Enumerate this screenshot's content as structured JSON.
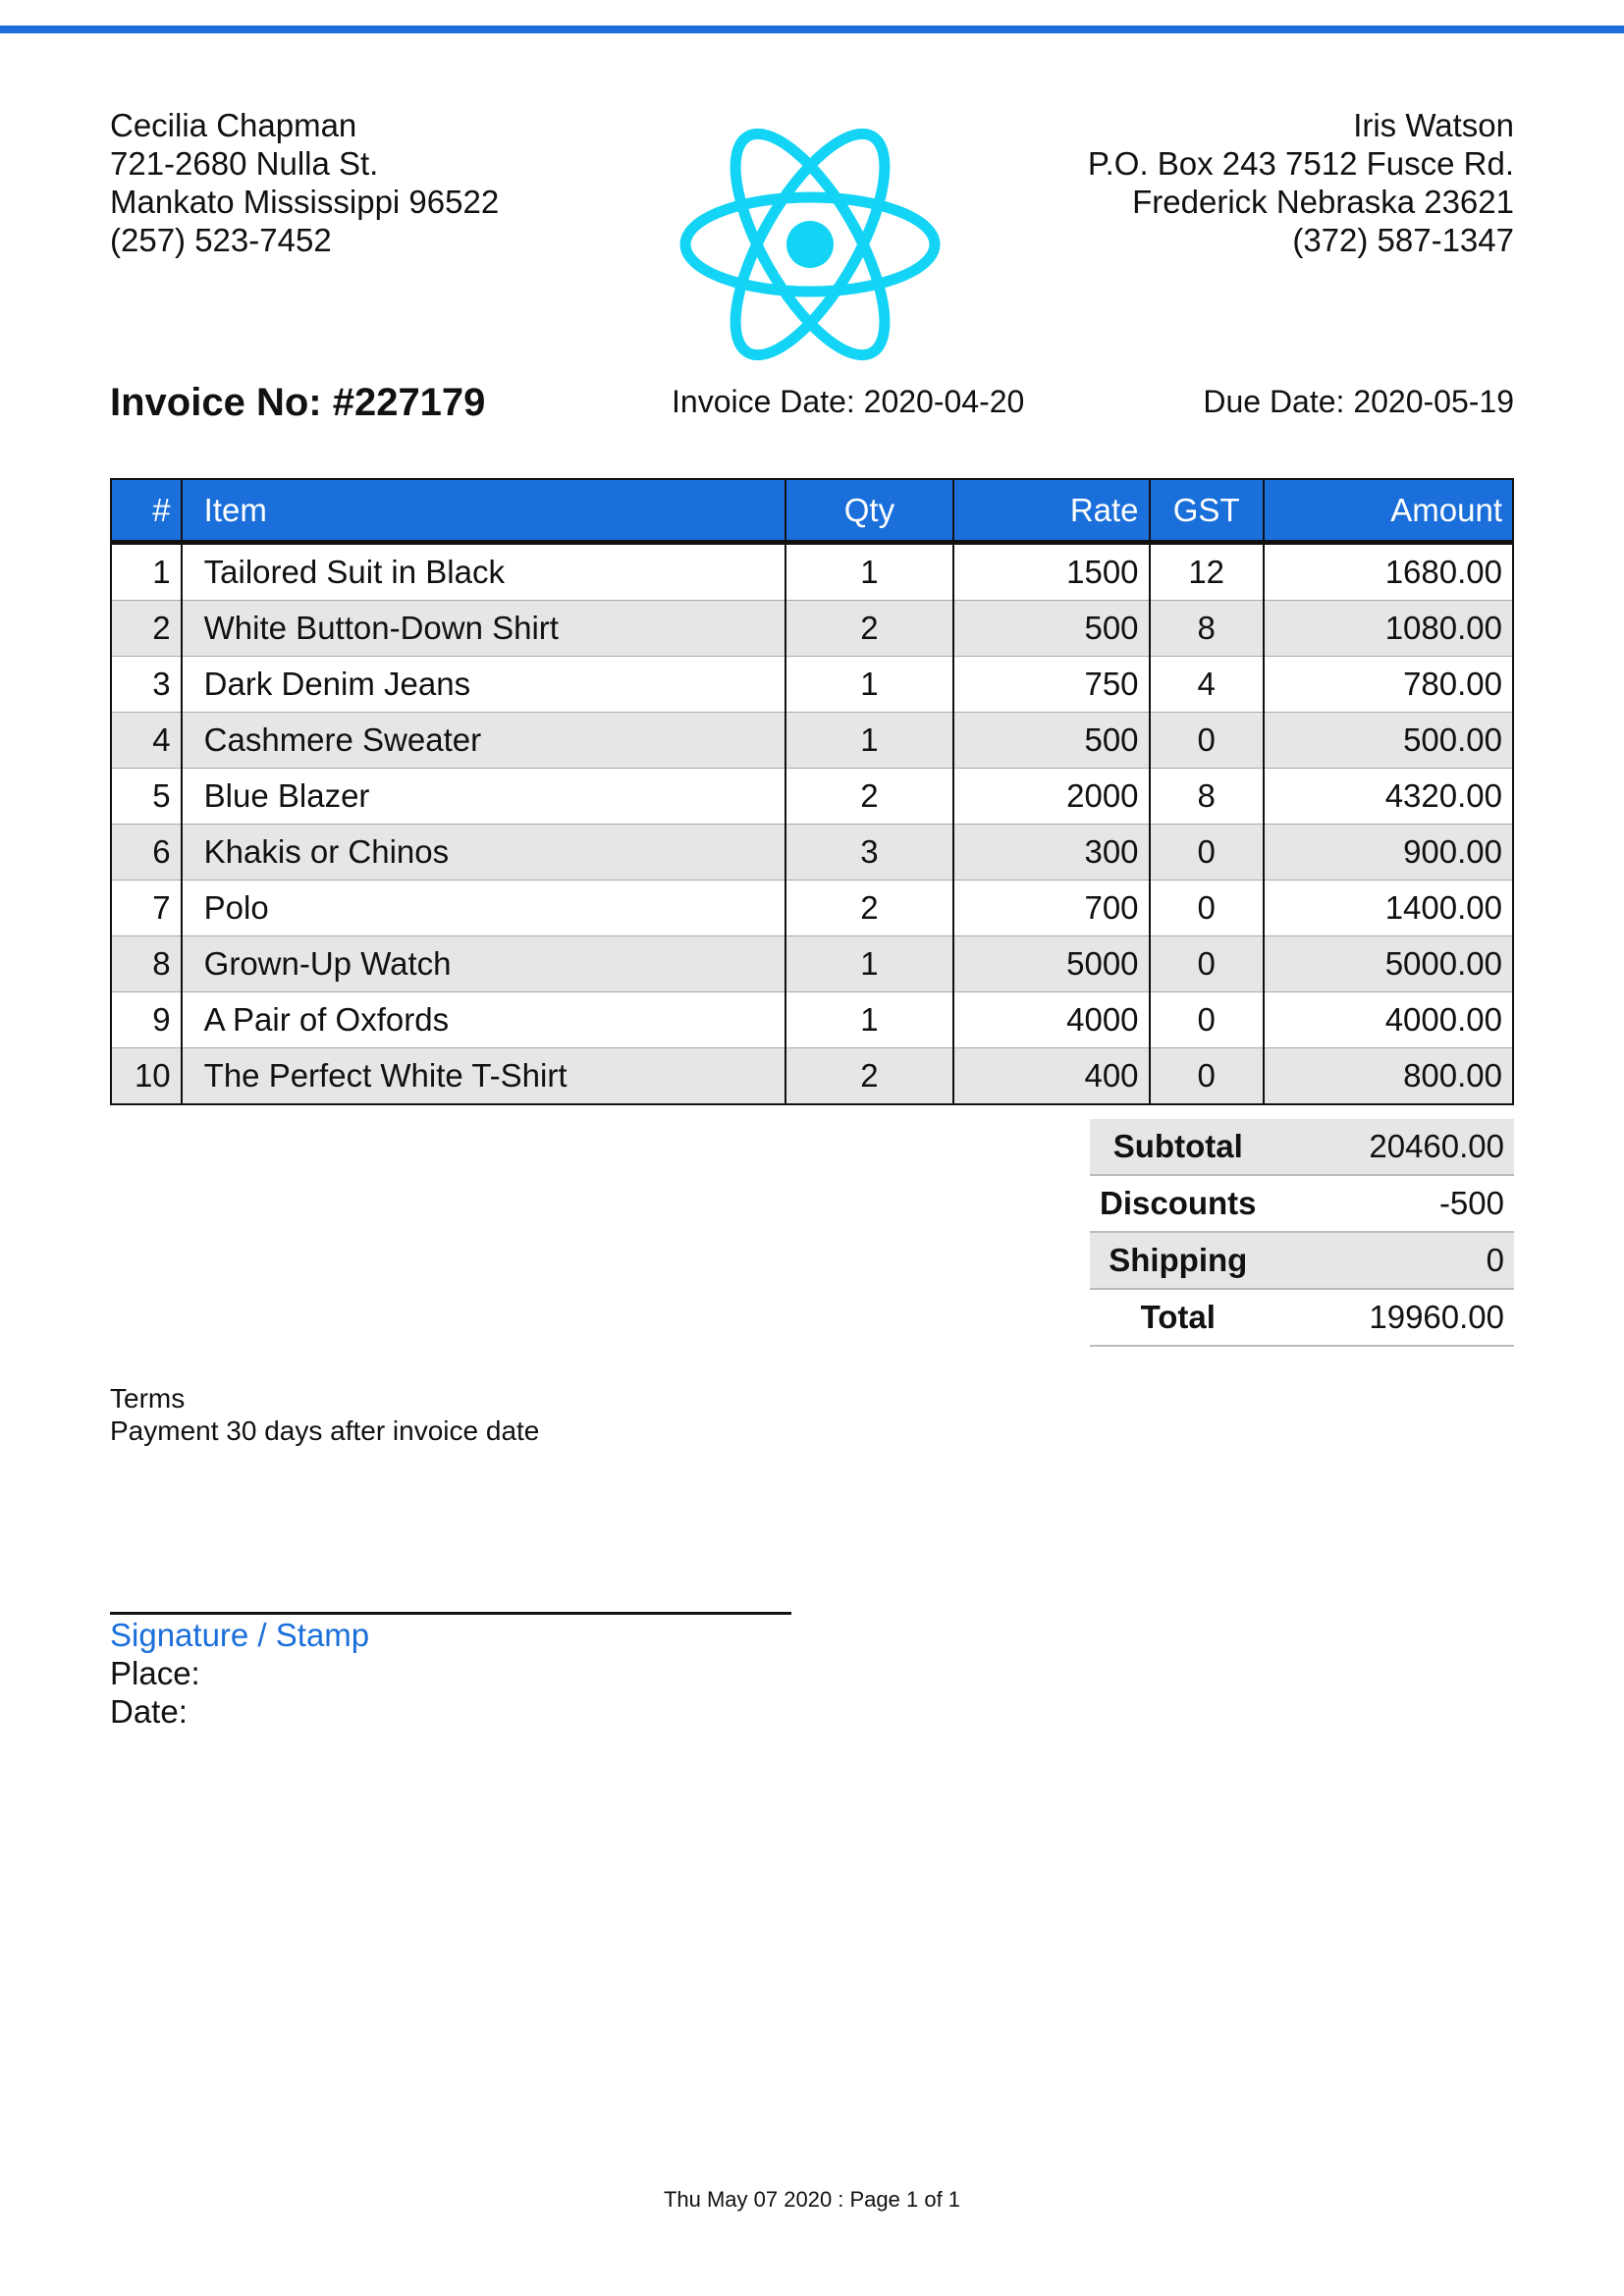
{
  "colors": {
    "accent": "#1a6fdb",
    "logo": "#13d4f5",
    "row_alt": "#e6e6e6"
  },
  "from": {
    "name": "Cecilia Chapman",
    "street": "721-2680 Nulla St.",
    "city": "Mankato Mississippi 96522",
    "phone": "(257) 523-7452"
  },
  "to": {
    "name": "Iris Watson",
    "street": "P.O. Box 243 7512 Fusce Rd.",
    "city": "Frederick Nebraska 23621",
    "phone": "(372) 587-1347"
  },
  "logo": {
    "icon": "react-atom-icon"
  },
  "invoice": {
    "number": "Invoice No: #227179",
    "date": "Invoice Date: 2020-04-20",
    "due": "Due Date: 2020-05-19"
  },
  "table": {
    "headers": {
      "num": "#",
      "item": "Item",
      "qty": "Qty",
      "rate": "Rate",
      "gst": "GST",
      "amount": "Amount"
    },
    "rows": [
      {
        "num": "1",
        "item": "Tailored Suit in Black",
        "qty": "1",
        "rate": "1500",
        "gst": "12",
        "amount": "1680.00"
      },
      {
        "num": "2",
        "item": "White Button-Down Shirt",
        "qty": "2",
        "rate": "500",
        "gst": "8",
        "amount": "1080.00"
      },
      {
        "num": "3",
        "item": "Dark Denim Jeans",
        "qty": "1",
        "rate": "750",
        "gst": "4",
        "amount": "780.00"
      },
      {
        "num": "4",
        "item": "Cashmere Sweater",
        "qty": "1",
        "rate": "500",
        "gst": "0",
        "amount": "500.00"
      },
      {
        "num": "5",
        "item": "Blue Blazer",
        "qty": "2",
        "rate": "2000",
        "gst": "8",
        "amount": "4320.00"
      },
      {
        "num": "6",
        "item": "Khakis or Chinos",
        "qty": "3",
        "rate": "300",
        "gst": "0",
        "amount": "900.00"
      },
      {
        "num": "7",
        "item": "Polo",
        "qty": "2",
        "rate": "700",
        "gst": "0",
        "amount": "1400.00"
      },
      {
        "num": "8",
        "item": "Grown-Up Watch",
        "qty": "1",
        "rate": "5000",
        "gst": "0",
        "amount": "5000.00"
      },
      {
        "num": "9",
        "item": "A Pair of Oxfords",
        "qty": "1",
        "rate": "4000",
        "gst": "0",
        "amount": "4000.00"
      },
      {
        "num": "10",
        "item": "The Perfect White T-Shirt",
        "qty": "2",
        "rate": "400",
        "gst": "0",
        "amount": "800.00"
      }
    ]
  },
  "totals": {
    "subtotal_label": "Subtotal",
    "subtotal": "20460.00",
    "discounts_label": "Discounts",
    "discounts": "-500",
    "shipping_label": "Shipping",
    "shipping": "0",
    "total_label": "Total",
    "total": "19960.00"
  },
  "terms": {
    "title": "Terms",
    "text": "Payment 30 days after invoice date"
  },
  "signature": {
    "title": "Signature / Stamp",
    "place": "Place:",
    "date": "Date:"
  },
  "footer": {
    "text": "Thu May 07 2020 : Page 1 of 1"
  }
}
